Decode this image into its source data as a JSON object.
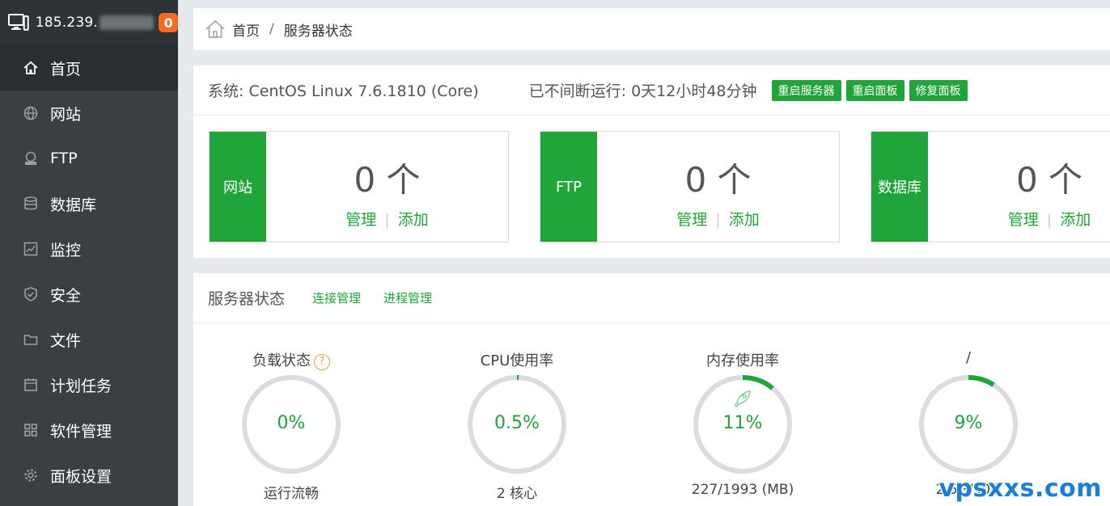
{
  "sidebar": {
    "ip_prefix": "185.239.",
    "badge": "0",
    "items": [
      {
        "label": "首页",
        "icon": "home-icon"
      },
      {
        "label": "网站",
        "icon": "globe-icon"
      },
      {
        "label": "FTP",
        "icon": "ftp-icon"
      },
      {
        "label": "数据库",
        "icon": "database-icon"
      },
      {
        "label": "监控",
        "icon": "monitor-icon"
      },
      {
        "label": "安全",
        "icon": "shield-icon"
      },
      {
        "label": "文件",
        "icon": "folder-icon"
      },
      {
        "label": "计划任务",
        "icon": "calendar-icon"
      },
      {
        "label": "软件管理",
        "icon": "grid-icon"
      },
      {
        "label": "面板设置",
        "icon": "gear-icon"
      }
    ]
  },
  "breadcrumb": {
    "home": "首页",
    "sep": "/",
    "current": "服务器状态"
  },
  "system": {
    "os": "系统: CentOS Linux 7.6.1810 (Core)",
    "uptime": "已不间断运行: 0天12小时48分钟",
    "buttons": [
      "重启服务器",
      "重启面板",
      "修复面板"
    ]
  },
  "stats": [
    {
      "label": "网站",
      "count": "0 个",
      "manage": "管理",
      "sep": "|",
      "add": "添加"
    },
    {
      "label": "FTP",
      "count": "0 个",
      "manage": "管理",
      "sep": "|",
      "add": "添加"
    },
    {
      "label": "数据库",
      "count": "0 个",
      "manage": "管理",
      "sep": "|",
      "add": "添加"
    }
  ],
  "status": {
    "title": "服务器状态",
    "tabs": [
      "连接管理",
      "进程管理"
    ],
    "gauges": [
      {
        "title": "负载状态",
        "value": "0%",
        "fraction": 0.0,
        "sub": "运行流畅",
        "help": "?"
      },
      {
        "title": "CPU使用率",
        "value": "0.5%",
        "fraction": 0.005,
        "sub": "2 核心"
      },
      {
        "title": "内存使用率",
        "value": "11%",
        "fraction": 0.11,
        "sub": "227/1993 (MB)"
      },
      {
        "title": "/",
        "value": "9%",
        "fraction": 0.09,
        "sub": "2.5G/30G"
      }
    ]
  },
  "watermark": "vpsxxs.com",
  "colors": {
    "accent": "#20a53a",
    "sidebar": "#3a3f44",
    "badge": "#f56c1e",
    "ring_track": "#dcdcdc"
  }
}
